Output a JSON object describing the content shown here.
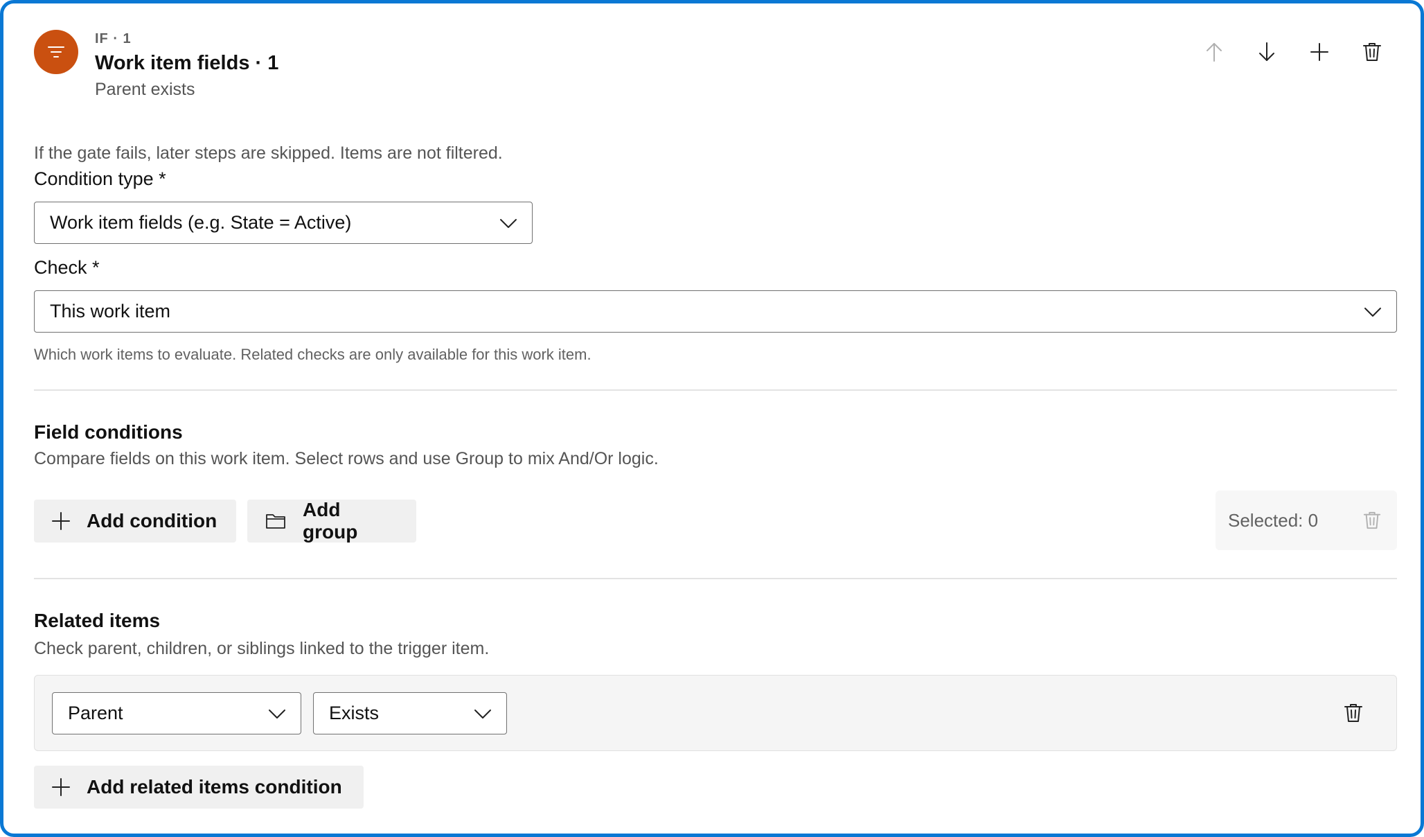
{
  "step": {
    "kicker": "IF · 1",
    "title": "Work item fields · 1",
    "subtitle": "Parent exists",
    "avatar_icon": "filter-icon",
    "accent_color": "#ca5010",
    "border_color": "#0a78d4"
  },
  "toolbar": {
    "move_up_icon": "arrow-up-icon",
    "move_down_icon": "arrow-down-icon",
    "add_icon": "plus-icon",
    "delete_icon": "trash-icon"
  },
  "gate_note": "If the gate fails, later steps are skipped. Items are not filtered.",
  "condition_type": {
    "label": "Condition type *",
    "value": "Work item fields (e.g. State = Active)"
  },
  "check": {
    "label": "Check *",
    "value": "This work item",
    "hint": "Which work items to evaluate. Related checks are only available for this work item."
  },
  "field_conditions": {
    "title": "Field conditions",
    "description": "Compare fields on this work item. Select rows and use Group to mix And/Or logic.",
    "add_condition_label": "Add condition",
    "add_group_label": "Add group",
    "selected_label": "Selected: 0"
  },
  "related_items": {
    "title": "Related items",
    "description": "Check parent, children, or siblings linked to the trigger item.",
    "rows": [
      {
        "relation": "Parent",
        "operator": "Exists"
      }
    ],
    "add_label": "Add related items condition"
  }
}
